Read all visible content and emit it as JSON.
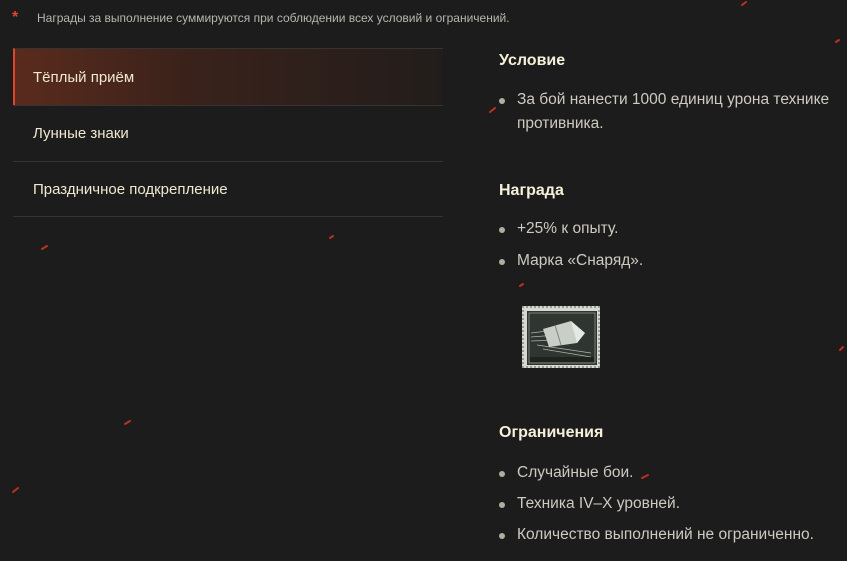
{
  "note": {
    "marker": "*",
    "text": "Награды за выполнение суммируются при соблюдении всех условий и ограничений."
  },
  "tabs": [
    {
      "label": "Тёплый приём",
      "active": true
    },
    {
      "label": "Лунные знаки",
      "active": false
    },
    {
      "label": "Праздничное подкрепление",
      "active": false
    }
  ],
  "condition": {
    "title": "Условие",
    "items": [
      "За бой нанести 1000 единиц урона технике противника."
    ]
  },
  "reward": {
    "title": "Награда",
    "items": [
      "+25% к опыту.",
      "Марка «Снаряд»."
    ],
    "stamp_icon": "shell-stamp-icon"
  },
  "limits": {
    "title": "Ограничения",
    "items": [
      "Случайные бои.",
      "Техника IV–X уровней.",
      "Количество выполнений не ограниченно."
    ]
  },
  "colors": {
    "background": "#1c1c1d",
    "accent": "#e0452a",
    "heading": "#f7f0d8",
    "text": "#cfcac0"
  }
}
